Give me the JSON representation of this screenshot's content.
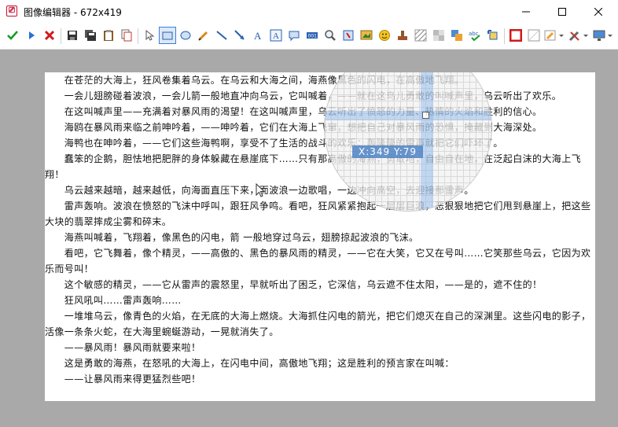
{
  "window": {
    "app_icon": "app-logo-icon",
    "title": "图像编辑器 - 672x419",
    "controls": [
      "minimize-icon",
      "maximize-icon",
      "close-icon"
    ]
  },
  "toolbar": {
    "icons": [
      "check-icon",
      "play-icon",
      "cancel-icon",
      "save-icon",
      "save-all-icon",
      "paste-icon",
      "copy-icon",
      "pointer-icon",
      "rectangle-icon",
      "ellipse-icon",
      "pencil-icon",
      "line-icon",
      "arrow-icon",
      "text-icon",
      "text-box-icon",
      "speech-bubble-icon",
      "counter-icon",
      "magnifier-icon",
      "crop-icon",
      "image-icon",
      "emoji-icon",
      "stamp-icon",
      "hatch-icon",
      "blur-icon",
      "shapes-icon",
      "spellcheck-icon",
      "resize-icon",
      "border-color-icon",
      "fill-color-icon",
      "highlight-dropdown-icon",
      "tools-dropdown-icon",
      "monitor-dropdown-icon",
      "settings-dropdown-icon"
    ],
    "colors": {
      "accent": "#3c7fd6",
      "border_swatch": "#d11a1a"
    }
  },
  "magnifier": {
    "coords": "X:349 Y:79"
  },
  "document": {
    "lines": [
      "　　在苍茫的大海上，狂风卷集着乌云。在乌云和大海之间，海燕像黑色的闪电，在高傲地飞翔。",
      "　　一会儿翅膀碰着波浪，一会儿箭一般地直冲向乌云，它叫喊着，——就在这鸟儿勇敢的叫喊声里，乌云听出了欢乐。",
      "　　在这叫喊声里——充满着对暴风雨的渴望！在这叫喊声里，乌云听出了愤怒的力量、热情的火焰和胜利的信心。",
      "　　海鸥在暴风雨来临之前呻吟着，——呻吟着，它们在大海上飞窜，想把自己对暴风雨的恐惧，掩藏到大海深处。",
      "　　海鸭也在呻吟着，——它们这些海鸭啊，享受不了生活的战斗的欢乐：轰隆隆的雷声就把它们吓坏了。",
      "　　蠢笨的企鹅，胆怯地把肥胖的身体躲藏在悬崖底下……只有那高傲的海燕，勇敢地，自由自在地，在泛起白沫的大海上飞翔！",
      "　　乌云越来越暗，越来越低，向海面直压下来，而波浪一边歌唱，一边冲向高空，去迎接那雷声。",
      "　　雷声轰响。波浪在愤怒的飞沫中呼叫，跟狂风争鸣。看吧，狂风紧紧抱起一层层巨浪，恶狠狠地把它们甩到悬崖上，把这些大块的翡翠摔成尘雾和碎末。",
      "　　海燕叫喊着，飞翔着，像黑色的闪电，箭 一般地穿过乌云，翅膀掠起波浪的飞沫。",
      "　　看吧，它飞舞着，像个精灵，——高傲的、黑色的暴风雨的精灵，——它在大笑，它又在号叫……它笑那些乌云，它因为欢乐而号叫！",
      "　　这个敏感的精灵，——它从雷声的震怒里，早就听出了困乏，它深信，乌云遮不住太阳，——是的，遮不住的！",
      "　　狂风吼叫……雷声轰响……",
      "　　一堆堆乌云，像青色的火焰，在无底的大海上燃烧。大海抓住闪电的箭光，把它们熄灭在自己的深渊里。这些闪电的影子，活像一条条火蛇，在大海里蜿蜒游动，一晃就消失了。",
      "　　——暴风雨！暴风雨就要来啦！",
      "　　这是勇敢的海燕，在怒吼的大海上，在闪电中间，高傲地飞翔；这是胜利的预言家在叫喊：",
      "　　——让暴风雨来得更猛烈些吧！"
    ]
  }
}
